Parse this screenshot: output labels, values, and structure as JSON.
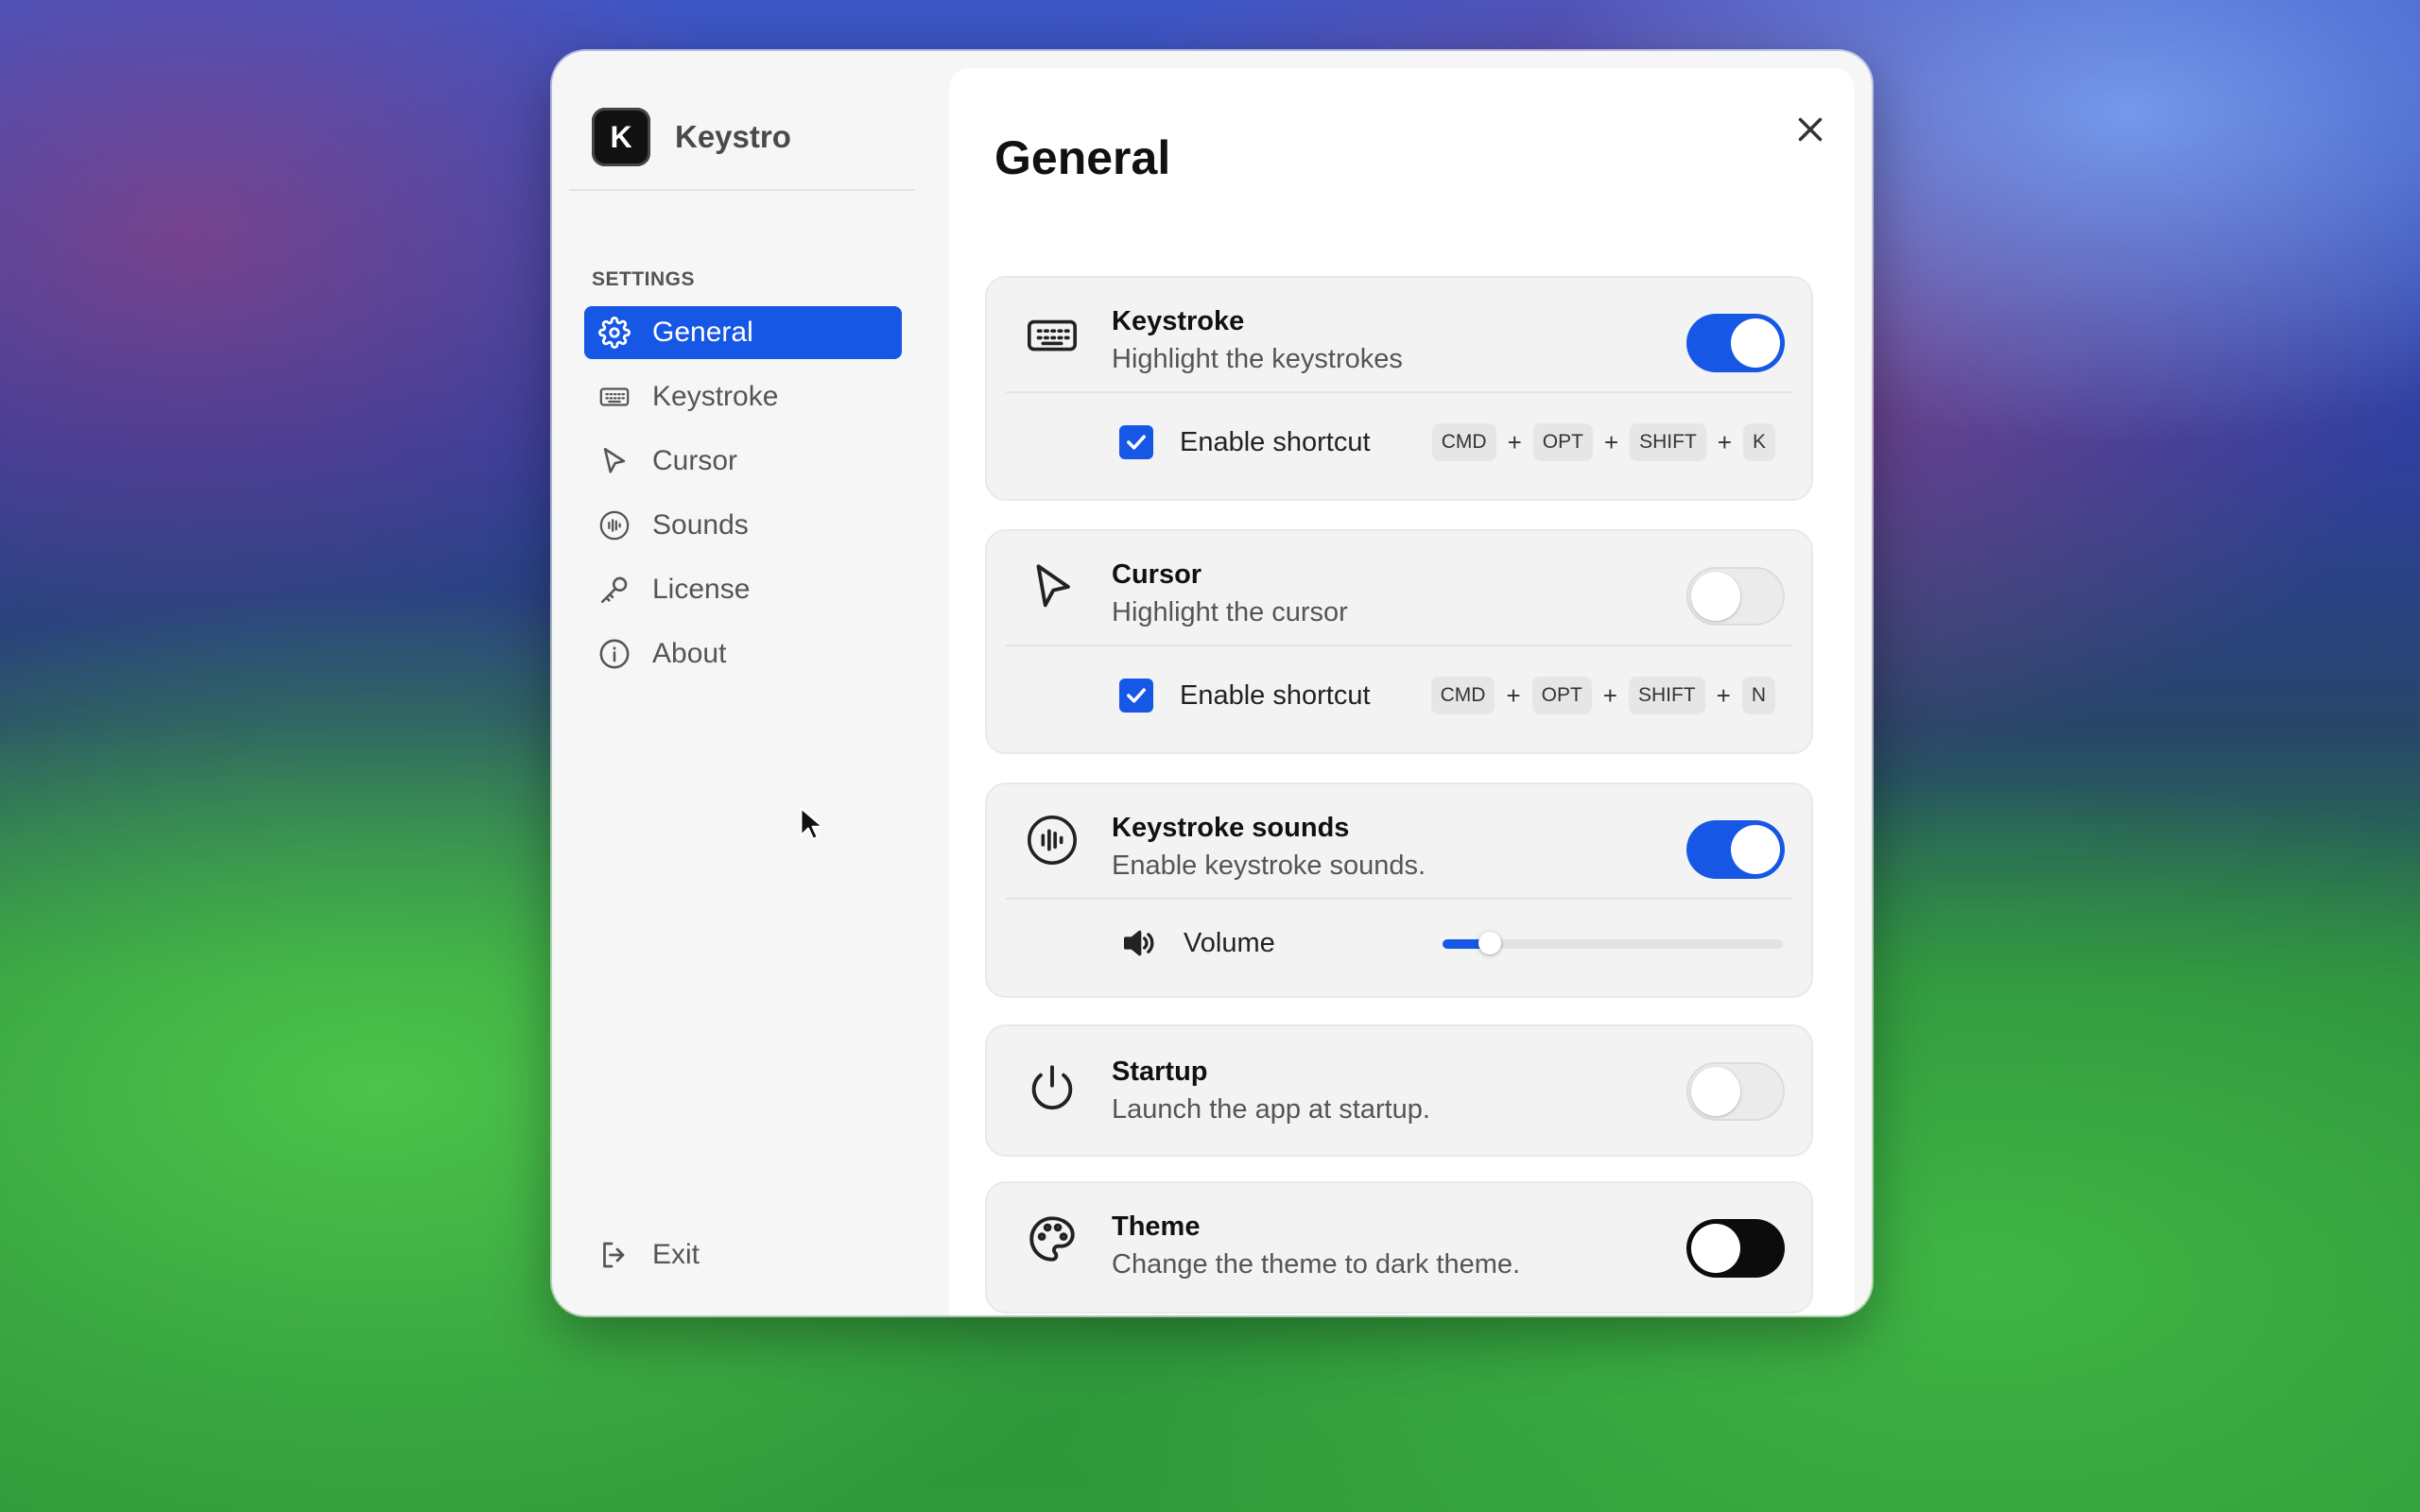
{
  "app": {
    "name": "Keystro",
    "logo_letter": "K"
  },
  "sidebar": {
    "section_label": "SETTINGS",
    "items": [
      {
        "label": "General",
        "icon": "gear-icon",
        "active": true
      },
      {
        "label": "Keystroke",
        "icon": "keyboard-icon",
        "active": false
      },
      {
        "label": "Cursor",
        "icon": "cursor-icon",
        "active": false
      },
      {
        "label": "Sounds",
        "icon": "sound-wave-icon",
        "active": false
      },
      {
        "label": "License",
        "icon": "key-icon",
        "active": false
      },
      {
        "label": "About",
        "icon": "info-icon",
        "active": false
      }
    ],
    "exit_label": "Exit"
  },
  "main": {
    "title": "General",
    "cards": {
      "keystroke": {
        "title": "Keystroke",
        "description": "Highlight the keystrokes",
        "enabled": true,
        "shortcut_label": "Enable shortcut",
        "shortcut_checked": true,
        "keys": [
          "CMD",
          "OPT",
          "SHIFT",
          "K"
        ]
      },
      "cursor": {
        "title": "Cursor",
        "description": "Highlight the cursor",
        "enabled": false,
        "shortcut_label": "Enable shortcut",
        "shortcut_checked": true,
        "keys": [
          "CMD",
          "OPT",
          "SHIFT",
          "N"
        ]
      },
      "sounds": {
        "title": "Keystroke sounds",
        "description": "Enable keystroke sounds.",
        "enabled": true,
        "volume_label": "Volume",
        "volume_level": 0.14
      },
      "startup": {
        "title": "Startup",
        "description": "Launch the app at startup.",
        "enabled": false
      },
      "theme": {
        "title": "Theme",
        "description": "Change the theme to dark theme.",
        "enabled": false
      }
    },
    "plus_sign": "+"
  },
  "colors": {
    "accent": "#1657e6",
    "text": "#111111",
    "muted": "#555555"
  }
}
